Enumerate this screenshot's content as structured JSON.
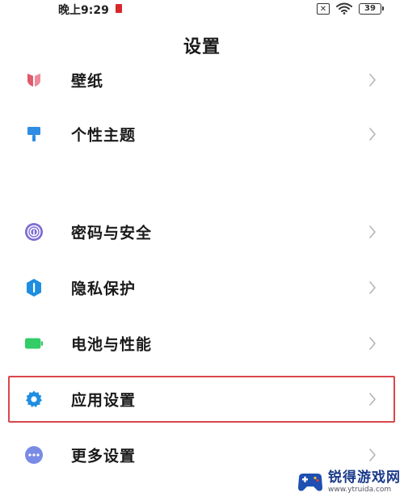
{
  "status_bar": {
    "time": "晚上9:29",
    "sim_icon": "sim-x-icon",
    "wifi_icon": "wifi-icon",
    "battery_level": "39"
  },
  "header": {
    "title": "设置"
  },
  "settings": {
    "items": [
      {
        "label": "壁纸",
        "icon": "wallpaper-icon",
        "color": "#e05a6d"
      },
      {
        "label": "个性主题",
        "icon": "theme-brush-icon",
        "color": "#2f8de4"
      },
      {
        "label": "密码与安全",
        "icon": "fingerprint-icon",
        "color": "#7c6bd6"
      },
      {
        "label": "隐私保护",
        "icon": "privacy-shield-icon",
        "color": "#1f8ee0"
      },
      {
        "label": "电池与性能",
        "icon": "battery-icon",
        "color": "#33cc66"
      },
      {
        "label": "应用设置",
        "icon": "gear-icon",
        "color": "#1f8ee0"
      },
      {
        "label": "更多设置",
        "icon": "more-dots-icon",
        "color": "#7a8be6"
      }
    ]
  },
  "watermark": {
    "name": "锐得游戏网",
    "url": "www.ytruida.com"
  }
}
